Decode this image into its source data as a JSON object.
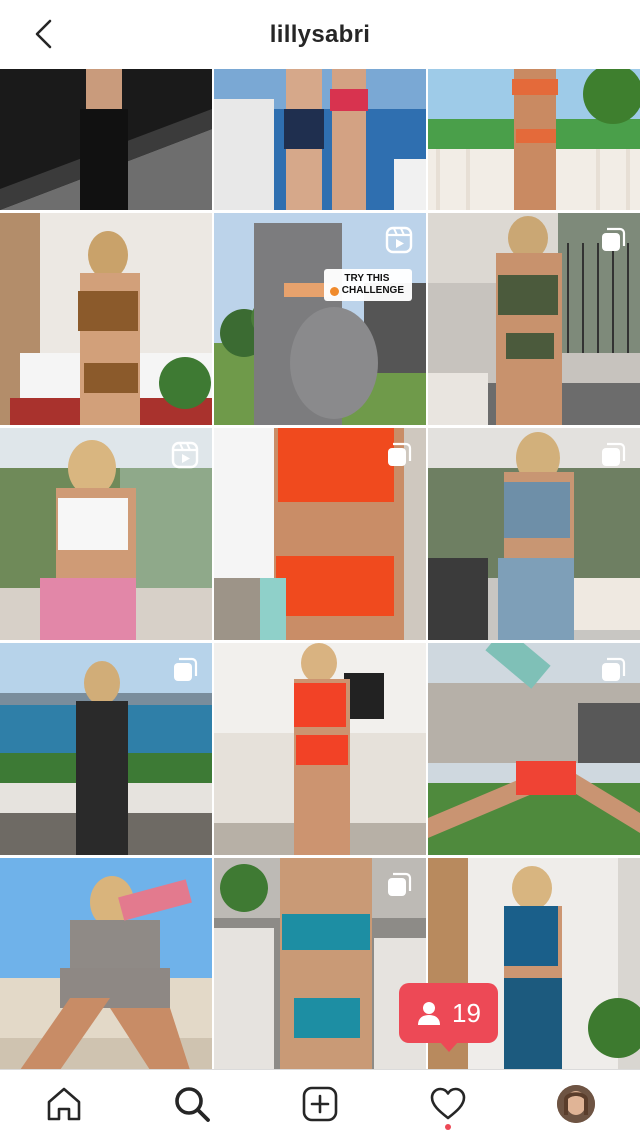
{
  "header": {
    "username": "lillysabri",
    "back_icon": "chevron-left-icon"
  },
  "grid": {
    "tiles": [
      {
        "badge": "none"
      },
      {
        "badge": "none"
      },
      {
        "badge": "none"
      },
      {
        "badge": "none"
      },
      {
        "badge": "reel",
        "overlay_text_line1": "TRY THIS",
        "overlay_text_line2": "CHALLENGE"
      },
      {
        "badge": "carousel"
      },
      {
        "badge": "reel"
      },
      {
        "badge": "carousel"
      },
      {
        "badge": "carousel"
      },
      {
        "badge": "carousel"
      },
      {
        "badge": "none"
      },
      {
        "badge": "carousel"
      },
      {
        "badge": "none"
      },
      {
        "badge": "carousel"
      },
      {
        "badge": "none"
      }
    ]
  },
  "notification": {
    "icon": "person-icon",
    "count": "19",
    "color": "#ed4956"
  },
  "bottom_nav": {
    "items": [
      "home-icon",
      "search-icon",
      "new-post-icon",
      "heart-icon",
      "profile-avatar"
    ]
  },
  "colors": {
    "accent": "#ed4956",
    "text": "#262626"
  }
}
